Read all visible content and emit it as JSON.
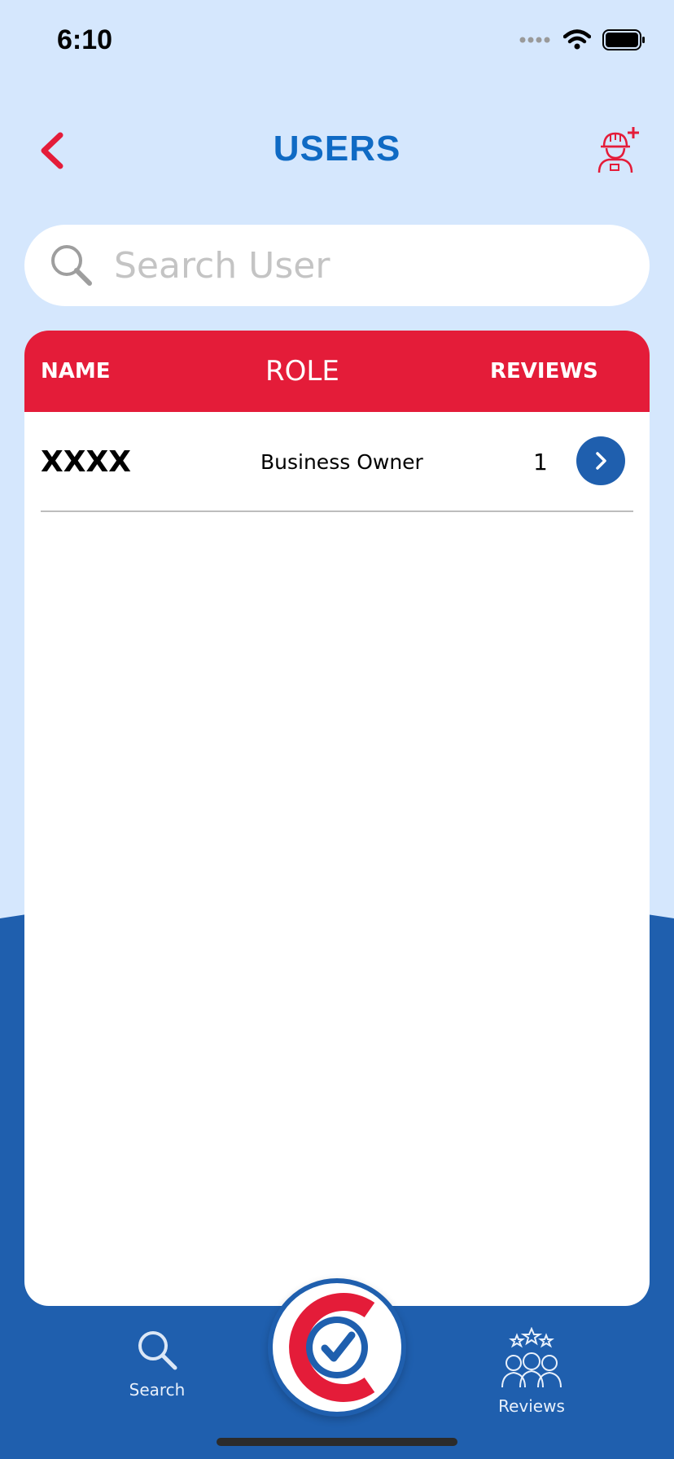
{
  "status_bar": {
    "time": "6:10"
  },
  "header": {
    "title": "USERS"
  },
  "search": {
    "placeholder": "Search User",
    "value": ""
  },
  "table": {
    "columns": {
      "name": "NAME",
      "role": "ROLE",
      "reviews": "REVIEWS"
    },
    "rows": [
      {
        "name": "XXXX",
        "role": "Business Owner",
        "reviews": "1"
      }
    ]
  },
  "tabs": [
    {
      "label": "Search",
      "icon": "search-icon"
    },
    {
      "label": "Reviews",
      "icon": "reviews-icon"
    }
  ],
  "colors": {
    "accent_red": "#e41c39",
    "brand_blue": "#1f5fae",
    "title_blue": "#0f6ac4",
    "background_light": "#d5e7fd"
  }
}
